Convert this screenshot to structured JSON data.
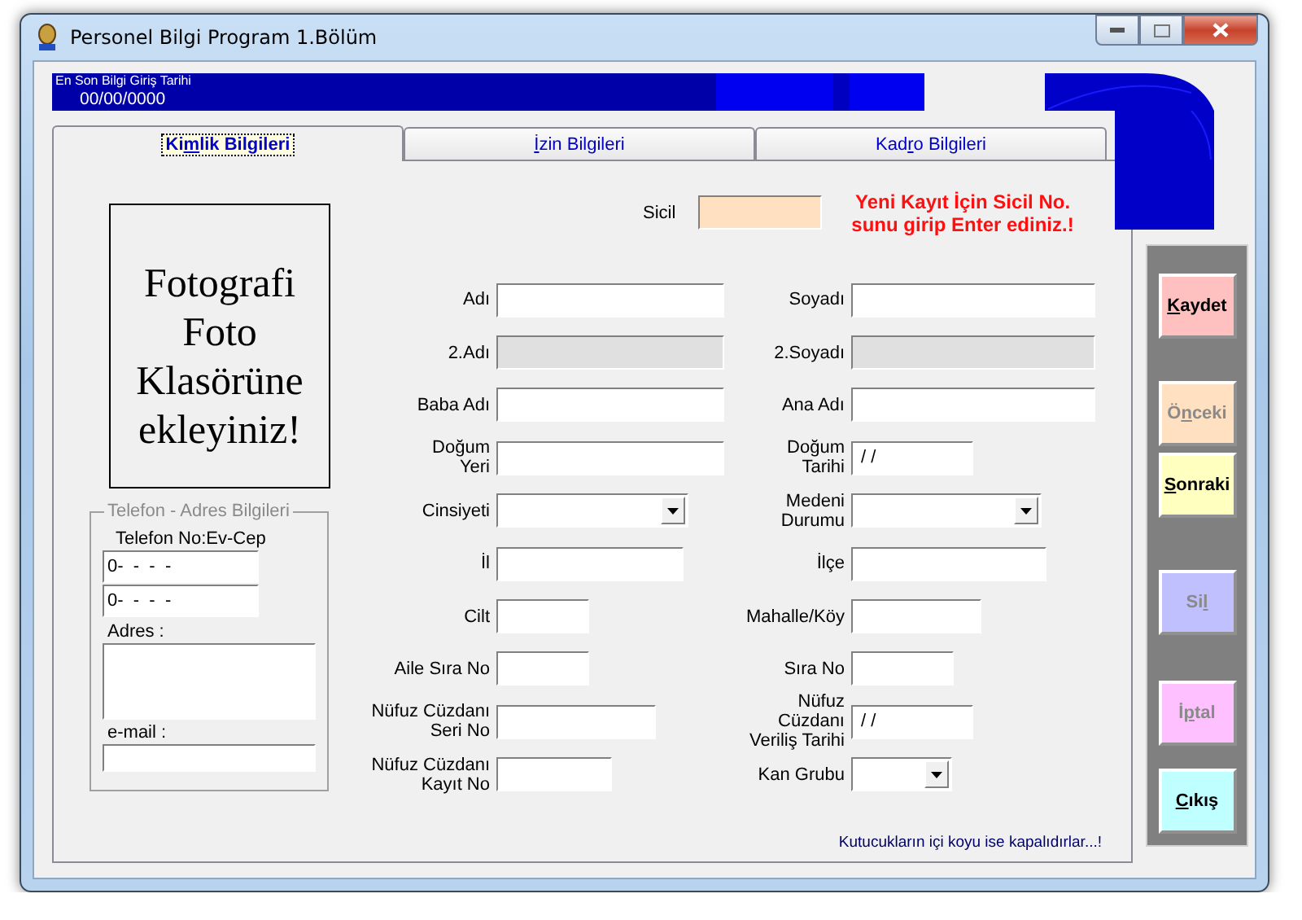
{
  "window": {
    "title": "Personel Bilgi Program 1.Bölüm"
  },
  "last_entry": {
    "label": "En Son Bilgi Giriş Tarihi",
    "value": "00/00/0000"
  },
  "tabs": [
    {
      "label": "Kimlik Bilgileri",
      "selected": true
    },
    {
      "label": "İzin Bilgileri",
      "selected": false
    },
    {
      "label": "Kadro Bilgileri",
      "selected": false
    }
  ],
  "photo_box": {
    "text": "Fotografi Foto Klasörüne ekleyiniz!"
  },
  "sicil": {
    "label": "Sicil"
  },
  "notice": {
    "lines": [
      "Yeni Kayıt İçin Sicil No.",
      "sunu girip Enter ediniz.!"
    ]
  },
  "contact_group": {
    "title": "Telefon - Adres Bilgileri",
    "phone_label": "Telefon No:Ev-Cep",
    "phones": [
      {
        "value": "0-  -  -  -"
      },
      {
        "value": "0-  -  -  -"
      }
    ],
    "address_label": "Adres :",
    "email_label": "e-mail :"
  },
  "rows": [
    [
      {
        "label": "Adı",
        "kind": "text",
        "disabled": false
      },
      {
        "label": "Soyadı",
        "kind": "text",
        "disabled": false
      }
    ],
    [
      {
        "label": "2.Adı",
        "kind": "text",
        "disabled": true
      },
      {
        "label": "2.Soyadı",
        "kind": "text",
        "disabled": true
      }
    ],
    [
      {
        "label": "Baba Adı",
        "kind": "text",
        "disabled": false
      },
      {
        "label": "Ana Adı",
        "kind": "text",
        "disabled": false
      }
    ],
    [
      {
        "label": "Doğum\nYeri",
        "kind": "text",
        "disabled": false
      },
      {
        "label": "Doğum\nTarihi",
        "kind": "text",
        "value": " / /",
        "disabled": false
      }
    ],
    [
      {
        "label": "Cinsiyeti",
        "kind": "combo",
        "disabled": false
      },
      {
        "label": "Medeni\nDurumu",
        "kind": "combo",
        "disabled": false
      }
    ],
    [
      {
        "label": "İl",
        "kind": "text",
        "disabled": false
      },
      {
        "label": "İlçe",
        "kind": "text",
        "disabled": false
      }
    ],
    [
      {
        "label": "Cilt",
        "kind": "text",
        "disabled": false
      },
      {
        "label": "Mahalle/Köy",
        "kind": "text",
        "disabled": false
      }
    ],
    [
      {
        "label": "Aile Sıra No",
        "kind": "text",
        "disabled": false
      },
      {
        "label": "Sıra No",
        "kind": "text",
        "disabled": false
      }
    ],
    [
      {
        "label": "Nüfuz Cüzdanı\nSeri No",
        "kind": "text",
        "disabled": false
      },
      {
        "label": "Nüfuz Cüzdanı\nVeriliş Tarihi",
        "kind": "text",
        "value": " / /",
        "disabled": false
      }
    ],
    [
      {
        "label": "Nüfuz Cüzdanı\nKayıt No",
        "kind": "text",
        "disabled": false
      },
      {
        "label": "Kan Grubu",
        "kind": "combo",
        "disabled": false
      }
    ]
  ],
  "buttons": [
    {
      "label": "Kaydet",
      "disabled": false,
      "color": "#ffc0c0"
    },
    {
      "label": "Önceki",
      "disabled": true,
      "color": "#ffe0c0"
    },
    {
      "label": "Sonraki",
      "disabled": false,
      "color": "#ffffc0"
    },
    {
      "label": "Sil",
      "disabled": true,
      "color": "#c0c0ff"
    },
    {
      "label": "İptal",
      "disabled": true,
      "color": "#ffc0ff"
    },
    {
      "label": "Cıkış",
      "disabled": false,
      "color": "#c0ffff"
    }
  ],
  "footer_note": "Kutucukların içi koyu ise kapalıdırlar...!"
}
